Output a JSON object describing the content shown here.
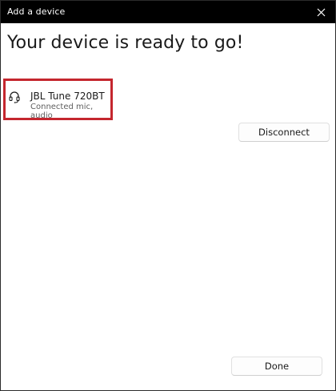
{
  "window": {
    "title": "Add a device",
    "close_icon": "close-icon"
  },
  "main": {
    "heading": "Your device is ready to go!"
  },
  "device": {
    "icon": "headset-icon",
    "name": "JBL Tune 720BT",
    "status": "Connected mic, audio",
    "highlight_color": "#c4262e"
  },
  "buttons": {
    "disconnect_label": "Disconnect",
    "done_label": "Done"
  }
}
